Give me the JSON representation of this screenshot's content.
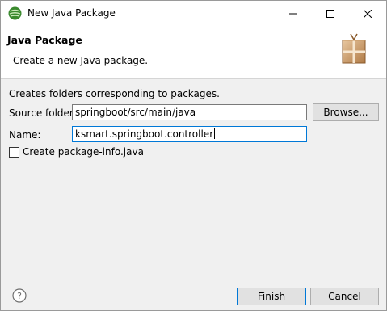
{
  "window": {
    "title": "New Java Package"
  },
  "header": {
    "title": "Java Package",
    "description": "Create a new Java package."
  },
  "body": {
    "description": "Creates folders corresponding to packages.",
    "source_folder_label": "Source folder:",
    "source_folder_value": "springboot/src/main/java",
    "browse_label": "Browse...",
    "name_label": "Name:",
    "name_value": "ksmart.springboot.controller",
    "package_info_label": "Create package-info.java",
    "package_info_checked": false
  },
  "footer": {
    "help_icon": "help-icon",
    "finish_label": "Finish",
    "cancel_label": "Cancel"
  },
  "colors": {
    "accent": "#0078d7",
    "dialog_bg": "#f0f0f0"
  }
}
